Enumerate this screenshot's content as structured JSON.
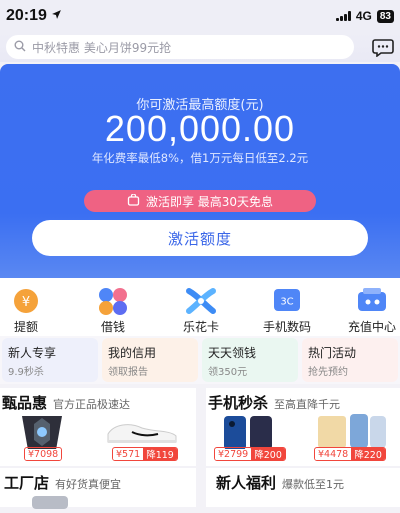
{
  "status": {
    "time": "20:19",
    "network": "4G",
    "battery": "83"
  },
  "search": {
    "placeholder": "中秋特惠 美心月饼99元抢"
  },
  "hero": {
    "label": "你可激活最高额度(元)",
    "amount": "200,000.00",
    "rate_note": "年化费率最低8%，借1万元每日低至2.2元",
    "promo": "激活即享 最高30天免息",
    "activate_button": "激活额度"
  },
  "services": [
    {
      "label": "提额",
      "icon": "yen-coin-icon"
    },
    {
      "label": "借钱",
      "icon": "grid-icon"
    },
    {
      "label": "乐花卡",
      "icon": "flower-card-icon"
    },
    {
      "label": "手机数码",
      "icon": "3c-icon"
    },
    {
      "label": "充值中心",
      "icon": "recharge-icon"
    }
  ],
  "shortcuts": [
    {
      "title": "新人专享",
      "sub": "9.9秒杀"
    },
    {
      "title": "我的信用",
      "sub": "领取报告"
    },
    {
      "title": "天天领钱",
      "sub": "领350元"
    },
    {
      "title": "热门活动",
      "sub": "抢先预约"
    }
  ],
  "deals": {
    "left": {
      "title": "甄品惠",
      "sub": "官方正品极速达",
      "items": [
        {
          "price": "¥7098",
          "discount": ""
        },
        {
          "price": "¥571",
          "discount": "降119"
        }
      ]
    },
    "right": {
      "title": "手机秒杀",
      "sub": "至高直降千元",
      "items": [
        {
          "price": "¥2799",
          "discount": "降200"
        },
        {
          "price": "¥4478",
          "discount": "降220"
        }
      ]
    }
  },
  "bottom": {
    "left": {
      "title": "工厂店",
      "sub": "有好货真便宜"
    },
    "right": {
      "title": "新人福利",
      "sub": "爆款低至1元"
    }
  },
  "colors": {
    "brand_blue": "#3d6ff0",
    "promo_pink": "#ef6283",
    "price_red": "#f1463c"
  }
}
